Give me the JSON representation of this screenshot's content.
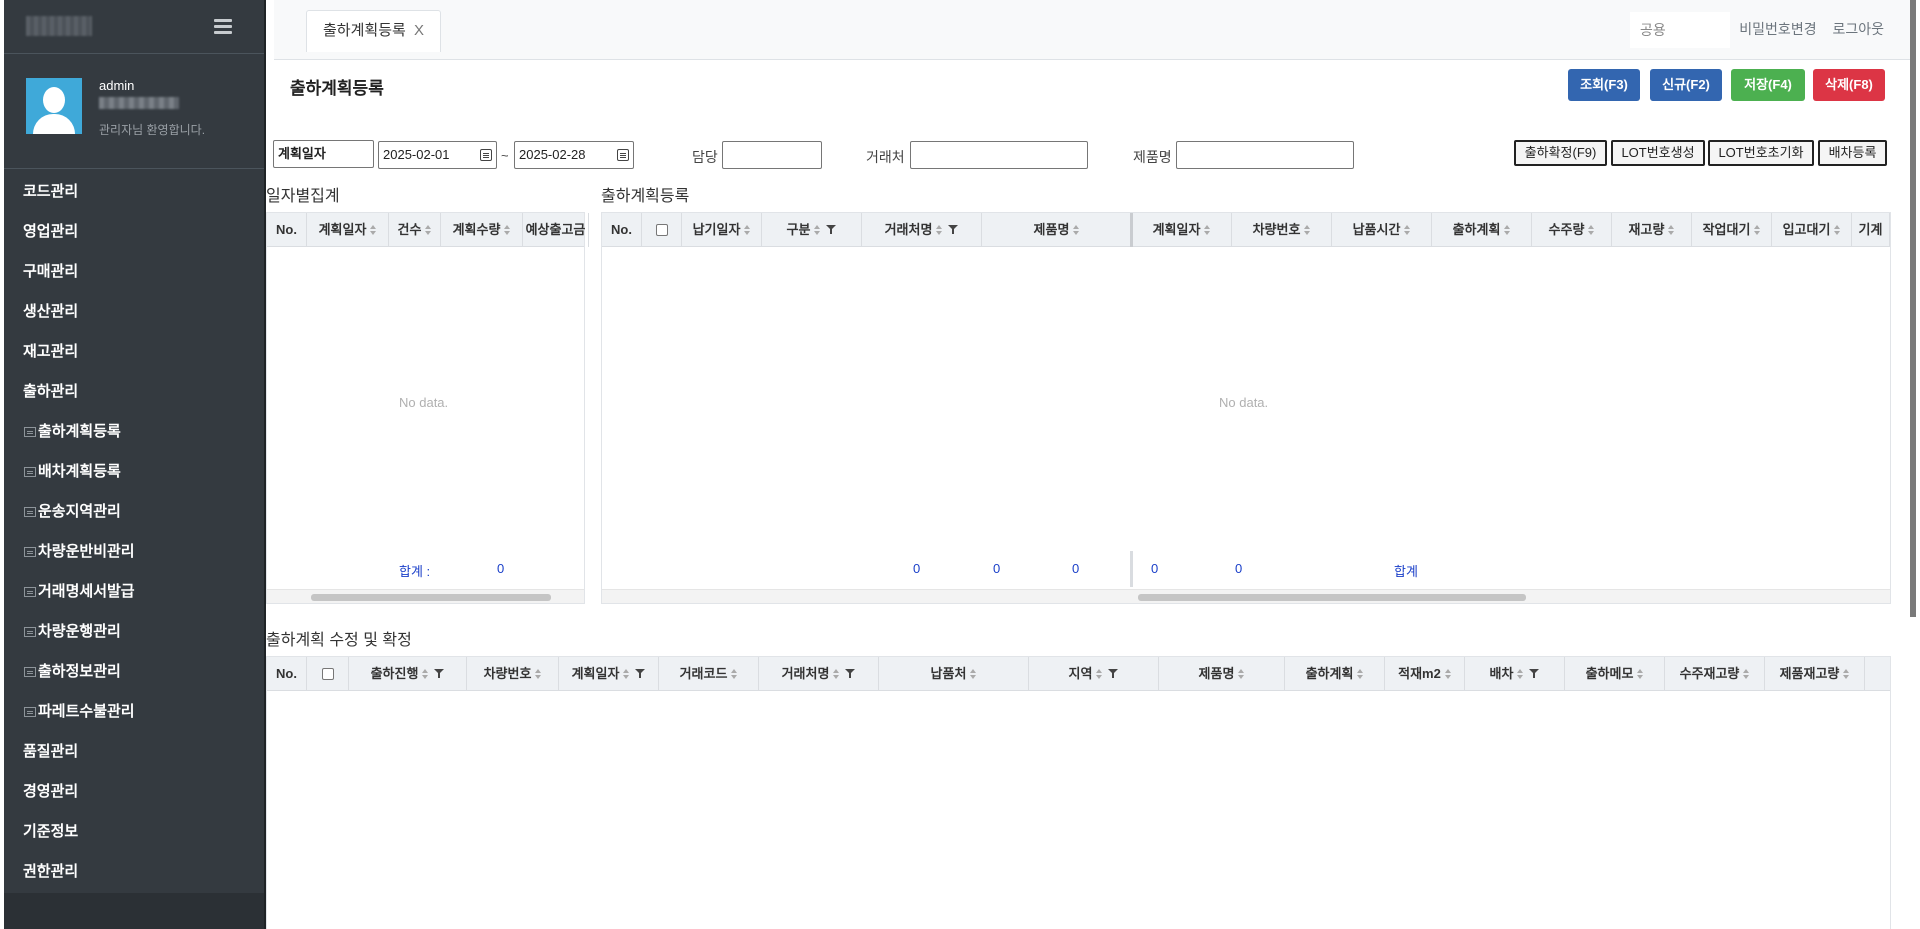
{
  "sidebar": {
    "user_name": "admin",
    "welcome": "관리자님 환영합니다.",
    "menu": [
      {
        "label": "코드관리",
        "sub": false
      },
      {
        "label": "영업관리",
        "sub": false
      },
      {
        "label": "구매관리",
        "sub": false
      },
      {
        "label": "생산관리",
        "sub": false
      },
      {
        "label": "재고관리",
        "sub": false
      },
      {
        "label": "출하관리",
        "sub": false
      },
      {
        "label": "출하계획등록",
        "sub": true
      },
      {
        "label": "배차계획등록",
        "sub": true
      },
      {
        "label": "운송지역관리",
        "sub": true
      },
      {
        "label": "차량운반비관리",
        "sub": true
      },
      {
        "label": "거래명세서발급",
        "sub": true
      },
      {
        "label": "차량운행관리",
        "sub": true
      },
      {
        "label": "출하정보관리",
        "sub": true
      },
      {
        "label": "파레트수불관리",
        "sub": true
      },
      {
        "label": "품질관리",
        "sub": false
      },
      {
        "label": "경영관리",
        "sub": false
      },
      {
        "label": "기준정보",
        "sub": false
      },
      {
        "label": "권한관리",
        "sub": false
      }
    ]
  },
  "topbar": {
    "tab_label": "출하계획등록",
    "tab_close": "X",
    "top_input": "공용",
    "change_password": "비밀번호변경",
    "logout": "로그아웃"
  },
  "page": {
    "title": "출하계획등록",
    "buttons": {
      "search": "조회(F3)",
      "new": "신규(F2)",
      "save": "저장(F4)",
      "delete": "삭제(F8)"
    }
  },
  "filters": {
    "date_type": "계획일자",
    "date_from": "2025-02-01",
    "tilde": "~",
    "date_to": "2025-02-28",
    "manager_label": "담당",
    "customer_label": "거래처",
    "product_label": "제품명",
    "actions": {
      "confirm": "출하확정(F9)",
      "lot_create": "LOT번호생성",
      "lot_reset": "LOT번호초기화",
      "dispatch": "배차등록"
    }
  },
  "daily_summary": {
    "title": "일자별집계",
    "columns": [
      "No.",
      "계획일자",
      "건수",
      "계획수량",
      "예상출고금"
    ],
    "empty": "No data.",
    "total_label": "합계 : ",
    "total_value": "0"
  },
  "plan_grid": {
    "title": "출하계획등록",
    "columns_left": [
      "No.",
      "납기일자",
      "구분",
      "거래처명",
      "제품명"
    ],
    "columns_right": [
      "계획일자",
      "차량번호",
      "납품시간",
      "출하계획",
      "수주량",
      "재고량",
      "작업대기",
      "입고대기",
      "기계"
    ],
    "empty": "No data.",
    "total_label": "합계",
    "totals": [
      "0",
      "0",
      "0",
      "0",
      "0"
    ]
  },
  "confirm_grid": {
    "title": "출하계획 수정 및 확정",
    "columns": [
      "No.",
      "출하진행",
      "차량번호",
      "계획일자",
      "거래코드",
      "거래처명",
      "납품처",
      "지역",
      "제품명",
      "출하계획",
      "적재m2",
      "배차",
      "출하메모",
      "수주재고량",
      "제품재고량"
    ]
  },
  "colors": {
    "sidebar_bg": "#343a40",
    "btn_blue": "#3366b0",
    "btn_green": "#4cb050",
    "btn_red": "#dc3545",
    "sum_blue": "#1a3fc9"
  }
}
